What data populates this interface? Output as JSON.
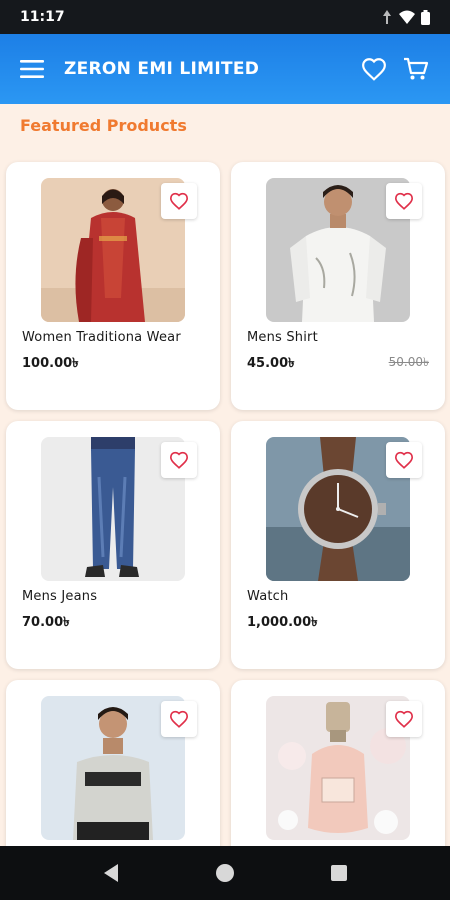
{
  "status_bar": {
    "time": "11:17"
  },
  "app_bar": {
    "title": "ZERON EMI LIMITED"
  },
  "section": {
    "title": "Featured Products"
  },
  "colors": {
    "primary": "#2b97f3",
    "accent": "#f07a30",
    "favorite": "#e0304a",
    "background": "#fdf0e6"
  },
  "products": [
    {
      "name": "Women Traditiona Wear",
      "price": "100.00৳",
      "old_price": ""
    },
    {
      "name": "Mens Shirt",
      "price": "45.00৳",
      "old_price": "50.00৳"
    },
    {
      "name": "Mens Jeans",
      "price": "70.00৳",
      "old_price": ""
    },
    {
      "name": "Watch",
      "price": "1,000.00৳",
      "old_price": ""
    },
    {
      "name": "",
      "price": "",
      "old_price": ""
    },
    {
      "name": "",
      "price": "",
      "old_price": ""
    }
  ]
}
